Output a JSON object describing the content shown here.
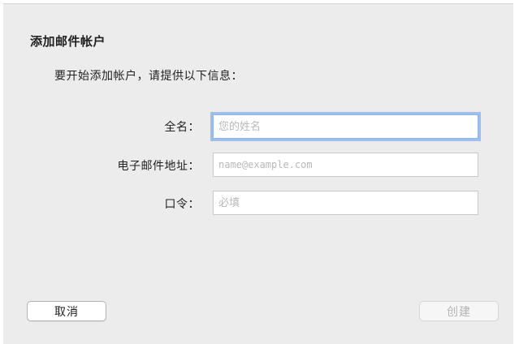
{
  "dialog": {
    "title": "添加邮件帐户",
    "subtitle": "要开始添加帐户，请提供以下信息："
  },
  "form": {
    "fullname": {
      "label": "全名：",
      "placeholder": "您的姓名",
      "value": ""
    },
    "email": {
      "label": "电子邮件地址：",
      "placeholder": "name@example.com",
      "value": ""
    },
    "password": {
      "label": "口令：",
      "placeholder": "必填",
      "value": ""
    }
  },
  "buttons": {
    "cancel_label": "取消",
    "create_label": "创建"
  },
  "colors": {
    "background": "#ececec",
    "focus_ring": "#78a5eb",
    "disabled_text": "#b5b5b5"
  }
}
